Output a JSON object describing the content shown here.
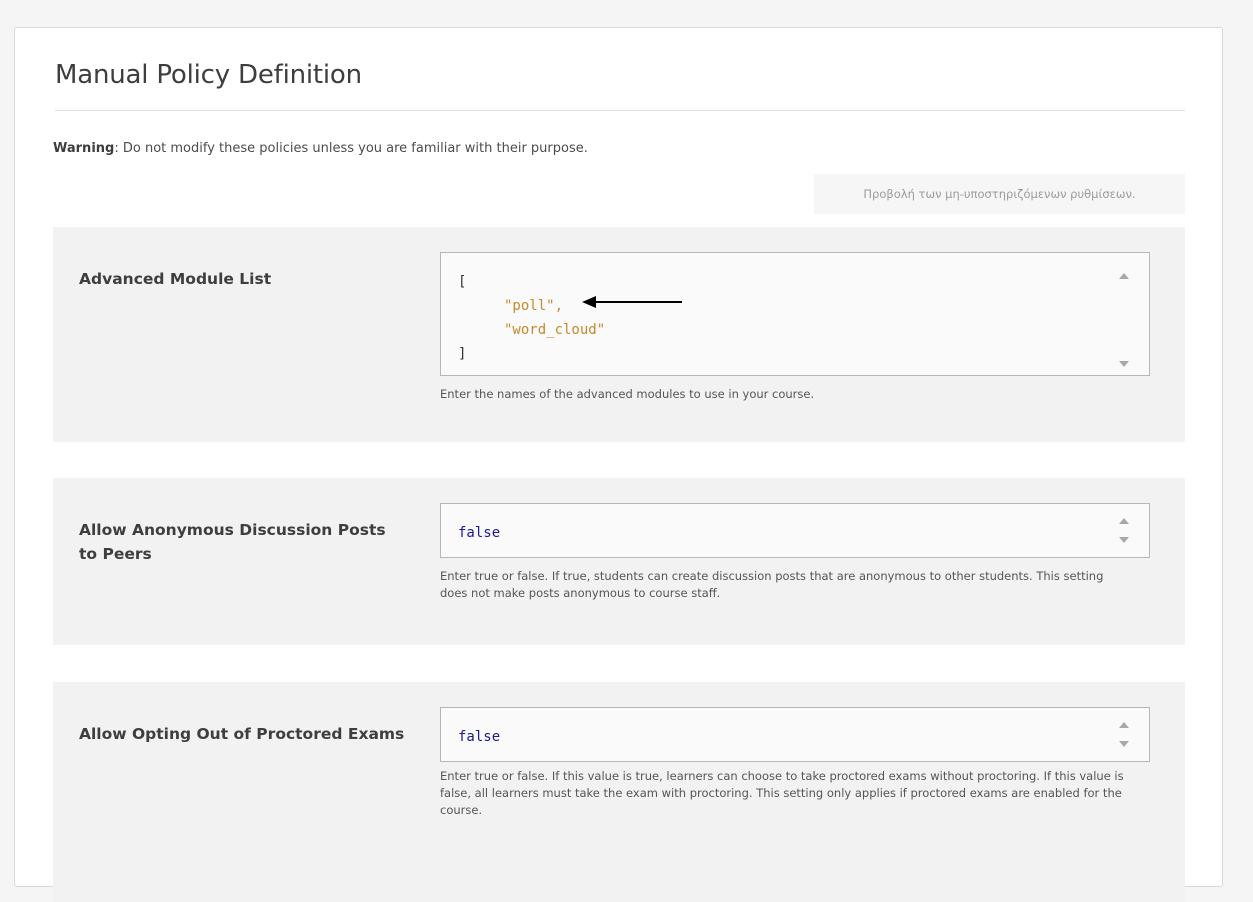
{
  "page": {
    "title": "Manual Policy Definition",
    "warning_label": "Warning",
    "warning_text": ": Do not modify these policies unless you are familiar with their purpose.",
    "deprecated_button": "Προβολή των μη-υποστηριζόμενων ρυθμίσεων."
  },
  "fields": [
    {
      "label": "Advanced Module List",
      "value_lines": [
        "[",
        "\"poll\",",
        "\"word_cloud\"",
        "]"
      ],
      "help": "Enter the names of the advanced modules to use in your course."
    },
    {
      "label": "Allow Anonymous Discussion Posts to Peers",
      "value": "false",
      "help": "Enter true or false. If true, students can create discussion posts that are anonymous to other students. This setting does not make posts anonymous to course staff."
    },
    {
      "label": "Allow Opting Out of Proctored Exams",
      "value": "false",
      "help": "Enter true or false. If this value is true, learners can choose to take proctored exams without proctoring. If this value is false, all learners must take the exam with proctoring. This setting only applies if proctored exams are enabled for the course."
    }
  ],
  "icons": {
    "annotation": "left-arrow-icon",
    "scroll_up": "chevron-up-icon",
    "scroll_down": "chevron-down-icon"
  },
  "colors": {
    "string": "#c48a2c",
    "keyword": "#1a1a8c",
    "field_bg": "#f2f2f2"
  }
}
